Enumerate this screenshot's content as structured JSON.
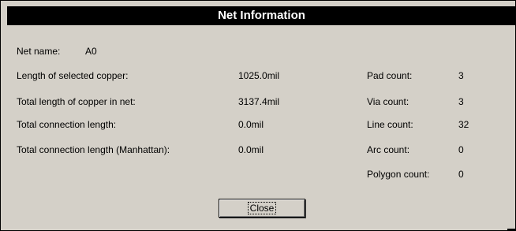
{
  "dialog": {
    "title": "Net Information",
    "net_name_label": "Net name:",
    "net_name_value": "A0",
    "left_rows": [
      {
        "label": "Length of selected copper:",
        "value": "1025.0mil"
      },
      {
        "label": "Total length of copper in net:",
        "value": "3137.4mil"
      },
      {
        "label": "Total connection length:",
        "value": "0.0mil"
      },
      {
        "label": "Total connection length (Manhattan):",
        "value": "0.0mil"
      }
    ],
    "right_rows": [
      {
        "label": "Pad count:",
        "value": "3"
      },
      {
        "label": "Via count:",
        "value": "3"
      },
      {
        "label": "Line count:",
        "value": "32"
      },
      {
        "label": "Arc count:",
        "value": "0"
      },
      {
        "label": "Polygon count:",
        "value": "0"
      }
    ],
    "close_label": "Close"
  }
}
